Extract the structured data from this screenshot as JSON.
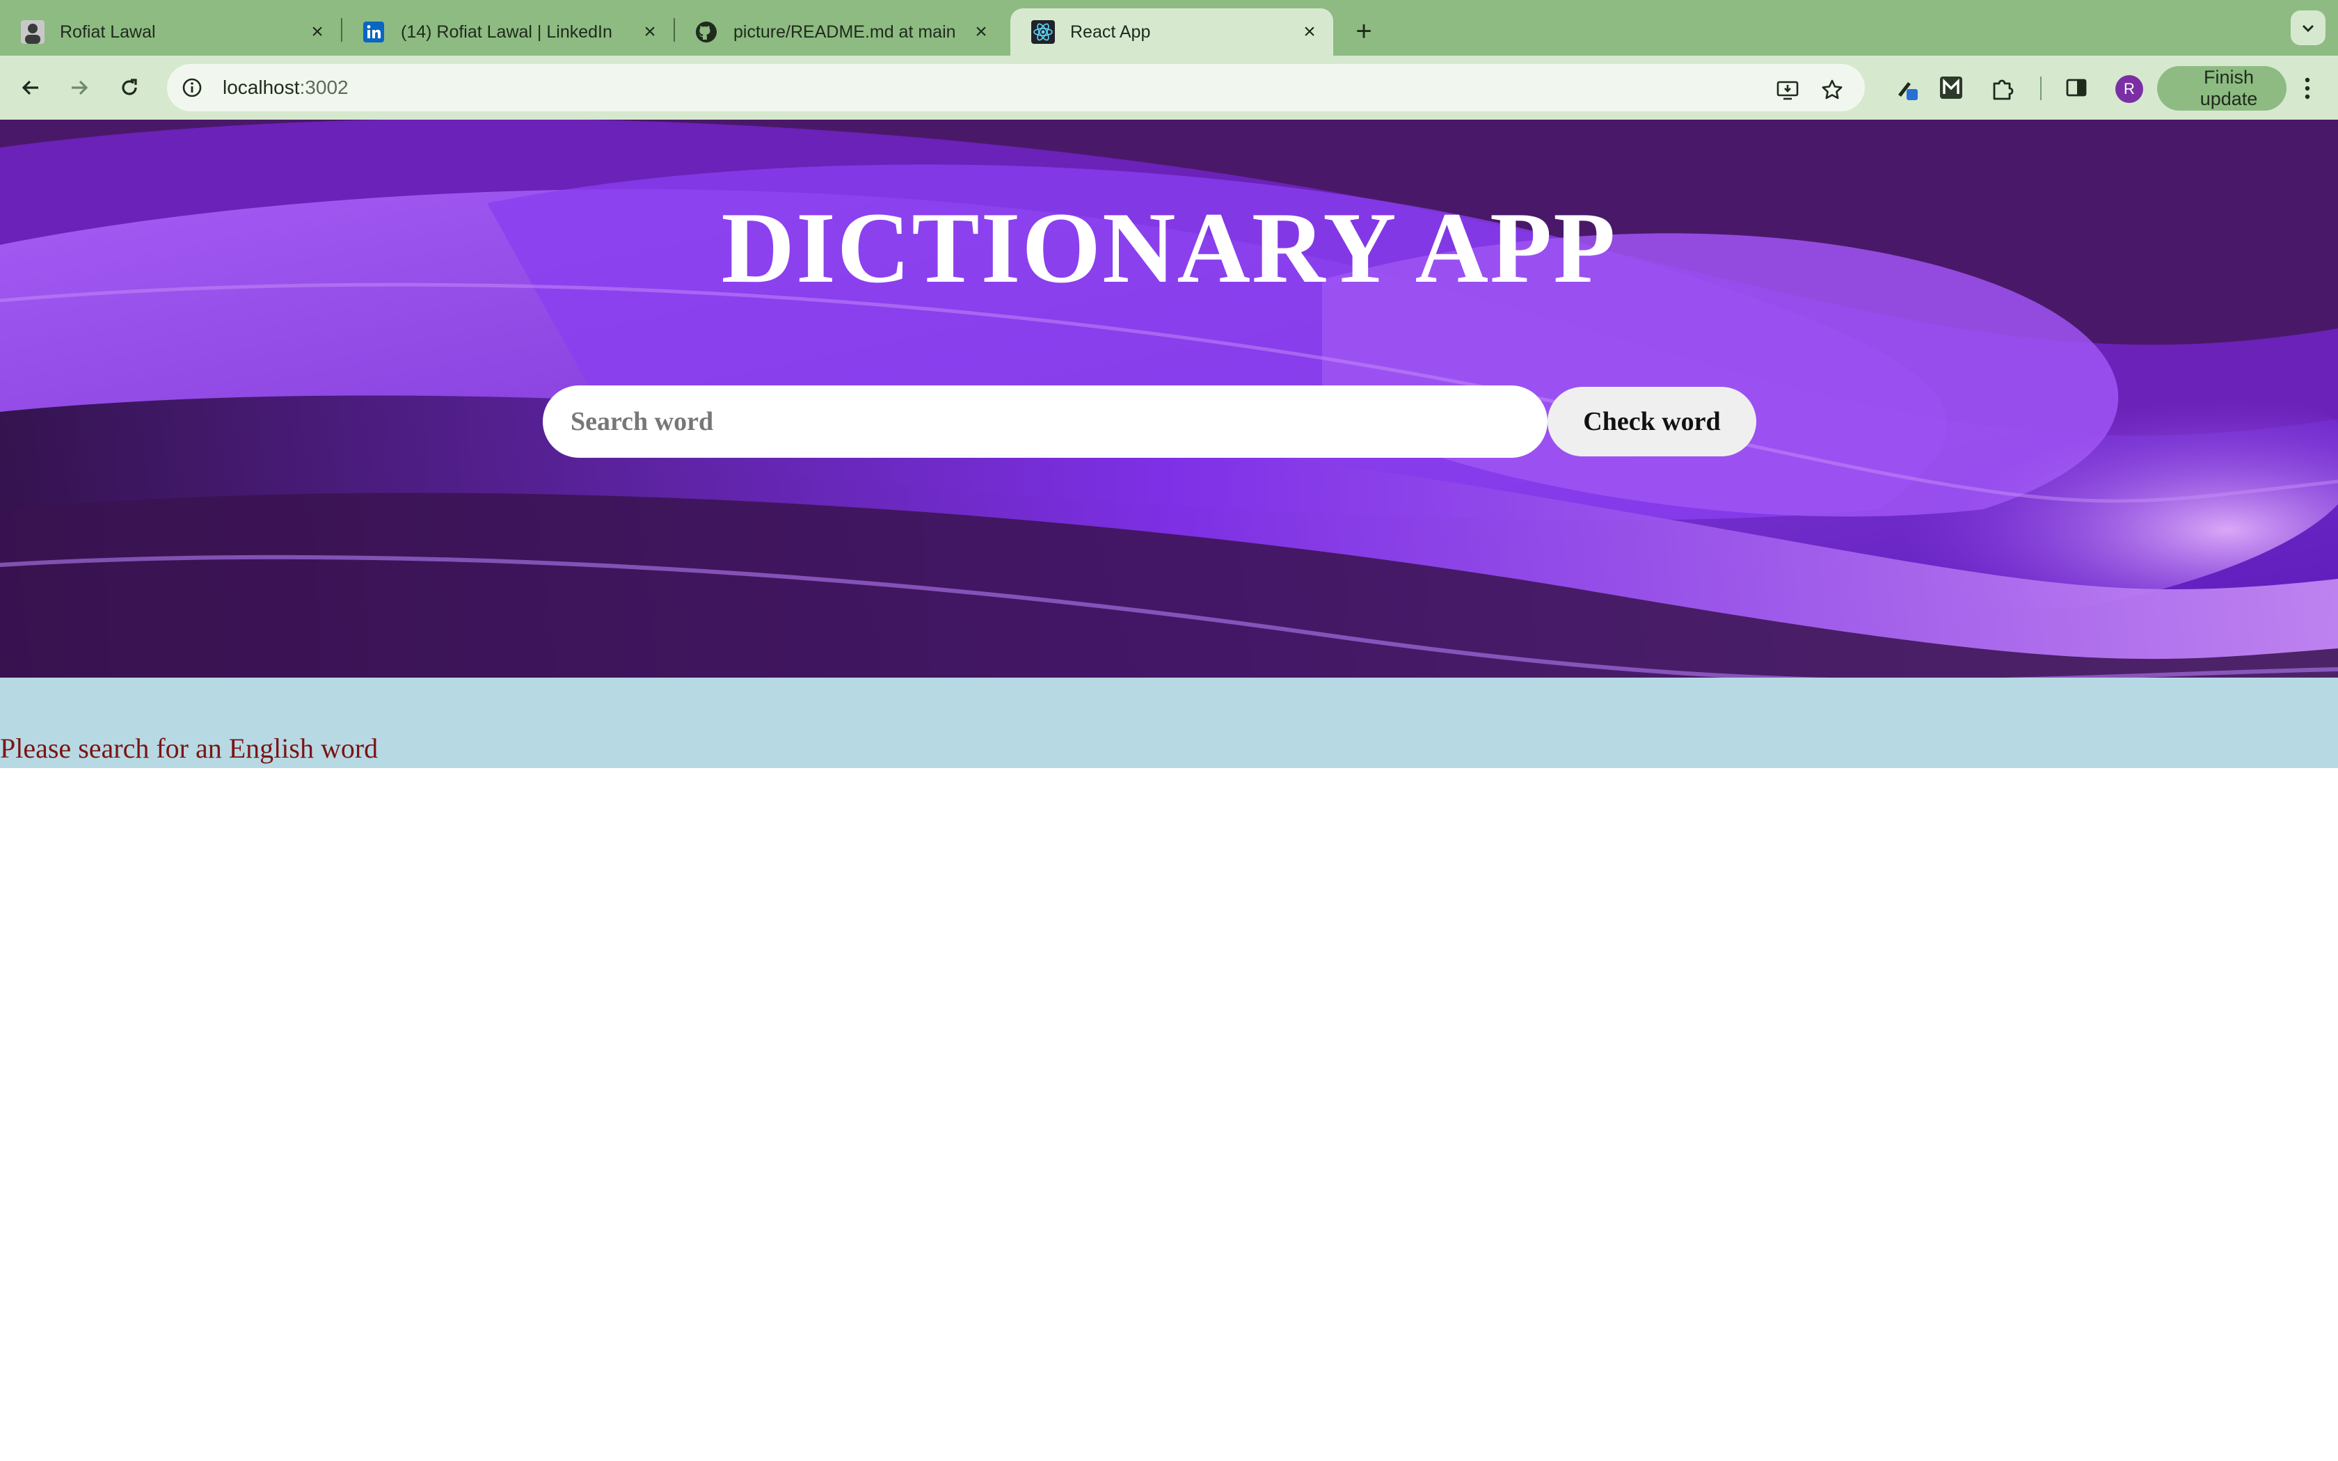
{
  "browser": {
    "tabs": [
      {
        "title": "Rofiat Lawal",
        "favicon": "avatar-icon",
        "active": false
      },
      {
        "title": "(14) Rofiat Lawal | LinkedIn",
        "favicon": "linkedin-icon",
        "active": false
      },
      {
        "title": "picture/README.md at main",
        "favicon": "github-icon",
        "active": false
      },
      {
        "title": "React App",
        "favicon": "react-icon",
        "active": true
      }
    ],
    "url_host": "localhost",
    "url_port": ":3002",
    "avatar_letter": "R",
    "finish_update_label": "Finish update",
    "colors": {
      "frame": "#8dbb82",
      "toolbar": "#d6e9cf",
      "avatar": "#7b2fa5"
    }
  },
  "app": {
    "title": "DICTIONARY APP",
    "search_placeholder": "Search word",
    "search_value": "",
    "check_button_label": "Check word",
    "message": "Please search for an English word",
    "colors": {
      "message_bg": "#b7d9e4",
      "message_text": "#7a1414"
    }
  }
}
